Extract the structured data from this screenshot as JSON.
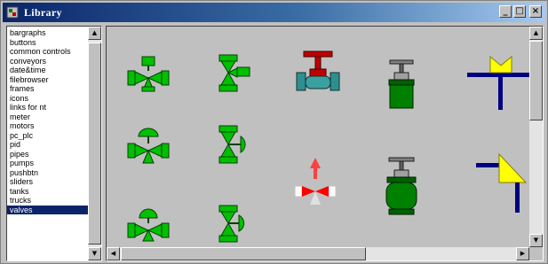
{
  "window": {
    "title": "Library",
    "minimize_glyph": "_",
    "maximize_glyph": "□",
    "close_glyph": "×"
  },
  "library_list": {
    "items": [
      "bargraphs",
      "buttons",
      "common controls",
      "conveyors",
      "date&time",
      "filebrowser",
      "frames",
      "icons",
      "links for nt",
      "meter",
      "motors",
      "pc_plc",
      "pid",
      "pipes",
      "pumps",
      "pushbtn",
      "sliders",
      "tanks",
      "trucks",
      "valves"
    ],
    "selected": "valves"
  },
  "scroll_glyphs": {
    "up": "▲",
    "down": "▼",
    "left": "◀",
    "right": "▶"
  },
  "symbols": [
    {
      "name": "three-way-valve-square-actuator-icon",
      "color": "#00c000"
    },
    {
      "name": "angle-valve-square-actuator-icon",
      "color": "#00c000"
    },
    {
      "name": "globe-valve-handwheel-icon",
      "color": "#c00000"
    },
    {
      "name": "gate-valve-handwheel-icon",
      "color": "#008000"
    },
    {
      "name": "tee-pipe-butterfly-valve-icon",
      "color": "#ffff00"
    },
    {
      "name": "three-way-valve-diaphragm-icon",
      "color": "#00c000"
    },
    {
      "name": "angle-valve-diaphragm-icon",
      "color": "#00c000"
    },
    {
      "name": "three-way-valve-red-flow-icon",
      "color": "#ff0000"
    },
    {
      "name": "diaphragm-valve-large-icon",
      "color": "#008000"
    },
    {
      "name": "corner-pipe-check-valve-icon",
      "color": "#ffff00"
    },
    {
      "name": "three-way-valve-dome-actuator-icon",
      "color": "#00c000"
    },
    {
      "name": "angle-valve-dome-actuator-icon",
      "color": "#00c000"
    }
  ],
  "colors": {
    "titlebar_start": "#0a246a",
    "titlebar_end": "#a6caf0",
    "selection": "#0a246a",
    "panel": "#c0c0c0",
    "valve_green": "#00c000",
    "pipe_navy": "#000080"
  }
}
